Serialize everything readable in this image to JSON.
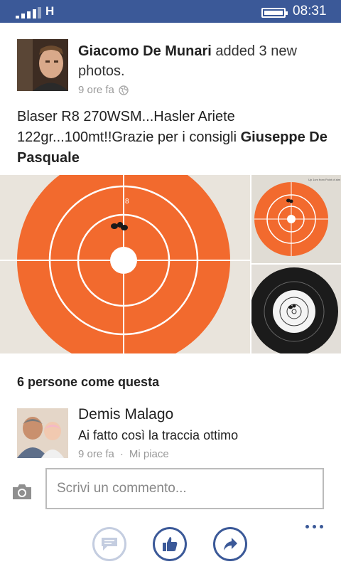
{
  "status_bar": {
    "network": "H",
    "time": "08:31"
  },
  "post": {
    "author": "Giacomo De Munari",
    "action": " added 3 new photos.",
    "time": "9 ore fa",
    "text": "Blaser R8 270WSM...Hasler Ariete 122gr...100mt!!Grazie per i consigli ",
    "mention": "Giuseppe De Pasquale",
    "target_ring_number": "8",
    "photo_note": "Up 1cm\nfrom Point of aim"
  },
  "likes": {
    "text": "6 persone come questa"
  },
  "comment": {
    "author": "Demis Malago",
    "text": "Ai fatto così la traccia ottimo",
    "time": "9 ore fa",
    "separator": "·",
    "like_label": "Mi piace"
  },
  "composer": {
    "placeholder": "Scrivi un commento..."
  },
  "colors": {
    "brand": "#3b5998",
    "target_orange": "#f26a2e"
  },
  "icons": [
    "signal-icon",
    "battery-icon",
    "globe-icon",
    "camera-icon",
    "comment-icon",
    "like-icon",
    "share-icon",
    "more-icon"
  ]
}
